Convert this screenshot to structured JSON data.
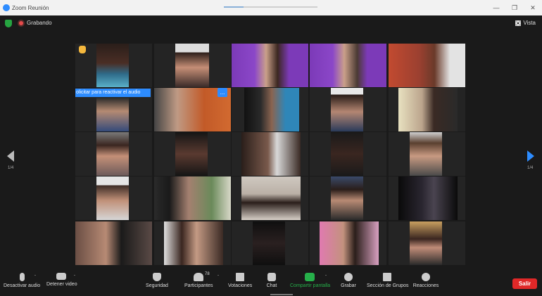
{
  "window": {
    "title": "Zoom Reunión"
  },
  "header": {
    "recording_label": "Grabando",
    "view_label": "Vista"
  },
  "notification": {
    "text": "olicitar para reactivar el audio",
    "more": "..."
  },
  "pagination": {
    "left": "1/4",
    "right": "1/4"
  },
  "toolbar": {
    "mute": "Desactivar audio",
    "video": "Detener video",
    "security": "Seguridad",
    "participants": "Participantes",
    "participants_count": "78",
    "polls": "Votaciones",
    "chat": "Chat",
    "share": "Compartir pantalla",
    "record": "Grabar",
    "breakout": "Sección de Grupos",
    "reactions": "Reacciones",
    "leave": "Salir"
  },
  "colors": {
    "accent": "#2d8cff",
    "active_speaker": "#d9e23b",
    "leave": "#e02828",
    "share": "#26b04a"
  }
}
